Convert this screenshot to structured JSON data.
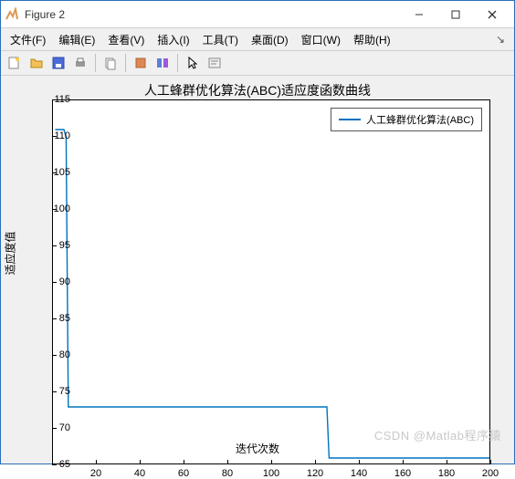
{
  "window": {
    "title": "Figure 2"
  },
  "menu": {
    "file": "文件(F)",
    "edit": "编辑(E)",
    "view": "查看(V)",
    "insert": "插入(I)",
    "tools": "工具(T)",
    "desktop": "桌面(D)",
    "window_": "窗口(W)",
    "help": "帮助(H)"
  },
  "chart_data": {
    "type": "line",
    "title": "人工蜂群优化算法(ABC)适应度函数曲线",
    "xlabel": "迭代次数",
    "ylabel": "适应度值",
    "xlim": [
      0,
      200
    ],
    "ylim": [
      65,
      115
    ],
    "xticks": [
      20,
      40,
      60,
      80,
      100,
      120,
      140,
      160,
      180,
      200
    ],
    "yticks": [
      65,
      70,
      75,
      80,
      85,
      90,
      95,
      100,
      105,
      110,
      115
    ],
    "series": [
      {
        "name": "人工蜂群优化算法(ABC)",
        "x": [
          1,
          2,
          3,
          4,
          5,
          6,
          7,
          8,
          9,
          10,
          20,
          40,
          60,
          80,
          100,
          120,
          125,
          126,
          127,
          128,
          140,
          160,
          180,
          200
        ],
        "y": [
          111,
          111,
          111,
          111,
          111,
          110,
          73,
          73,
          73,
          73,
          73,
          73,
          73,
          73,
          73,
          73,
          73,
          66,
          66,
          66,
          66,
          66,
          66,
          66
        ]
      }
    ]
  },
  "watermark": "CSDN @Matlab程序猿"
}
